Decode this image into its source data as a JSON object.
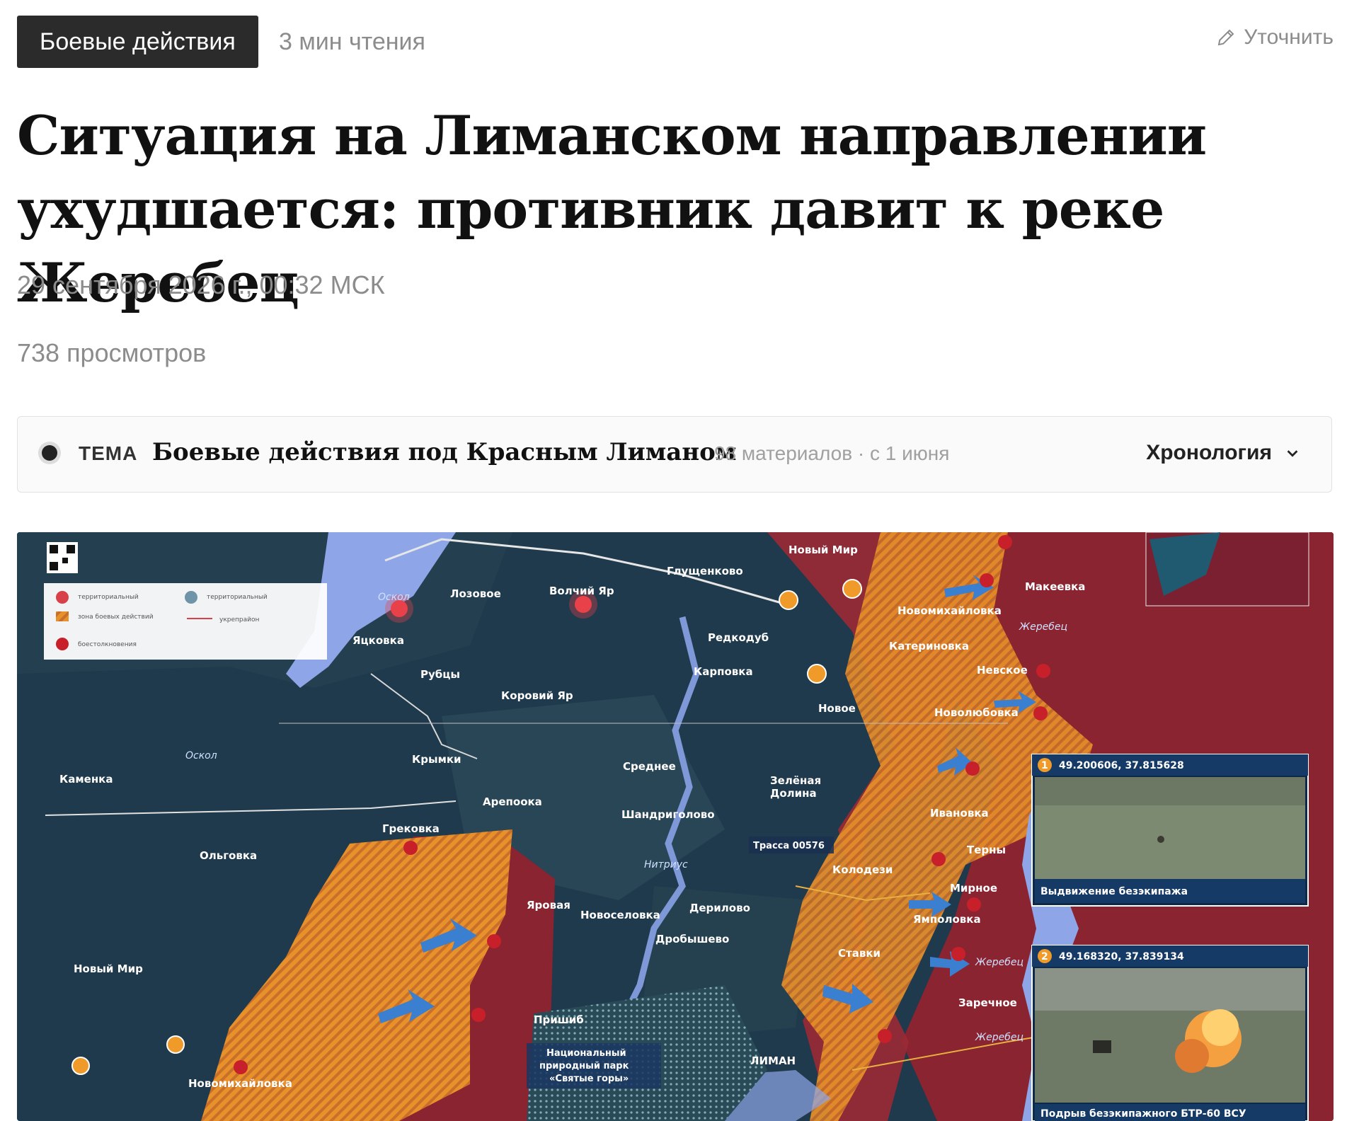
{
  "header": {
    "tag": "Боевые действия",
    "read_time": "3 мин чтения",
    "clarify": "Уточнить"
  },
  "article": {
    "title": "Ситуация на Лиманском направлении ухудшается: противник давит к реке Жеребец",
    "date": "29 сентября 2026 г., 00:32 МСК",
    "views": "738 просмотров"
  },
  "topic": {
    "tag": "ТЕМА",
    "title": "Боевые действия под Красным Лиманом",
    "meta": "98 материалов · с 1 июня",
    "chronology": "Хронология"
  },
  "map": {
    "places": [
      {
        "id": "lozovoe",
        "text": "Лозовое"
      },
      {
        "id": "volchiy",
        "text": "Волчий Яр"
      },
      {
        "id": "glush",
        "text": "Глущенково"
      },
      {
        "id": "novyimir1",
        "text": "Новый Мир"
      },
      {
        "id": "makeevka",
        "text": "Макеевка"
      },
      {
        "id": "novomikh1",
        "text": "Новомихайловка"
      },
      {
        "id": "zherebets1",
        "text": "Жеребец"
      },
      {
        "id": "yatskovka",
        "text": "Яцковка"
      },
      {
        "id": "rubtsy",
        "text": "Рубцы"
      },
      {
        "id": "redkodub",
        "text": "Редкодуб"
      },
      {
        "id": "katerinovka",
        "text": "Катериновка"
      },
      {
        "id": "karpovka",
        "text": "Карповка"
      },
      {
        "id": "nevskoe",
        "text": "Невское"
      },
      {
        "id": "koroviy",
        "text": "Коровий Яр"
      },
      {
        "id": "novoe",
        "text": "Новое"
      },
      {
        "id": "novolyub",
        "text": "Новолюбовка"
      },
      {
        "id": "oskol1",
        "text": "Оскол"
      },
      {
        "id": "oskol2",
        "text": "Оскол"
      },
      {
        "id": "kamenka",
        "text": "Каменка"
      },
      {
        "id": "krymki",
        "text": "Крымки"
      },
      {
        "id": "srednee",
        "text": "Среднее"
      },
      {
        "id": "zelenaya",
        "text": "Зелёная"
      },
      {
        "id": "dolina",
        "text": "Долина"
      },
      {
        "id": "arepovka",
        "text": "Арепоока"
      },
      {
        "id": "grekovka",
        "text": "Грековка"
      },
      {
        "id": "shandr",
        "text": "Шандриголово"
      },
      {
        "id": "ivanovka",
        "text": "Ивановка"
      },
      {
        "id": "olgovka",
        "text": "Ольговка"
      },
      {
        "id": "trassa",
        "text": "Трасса 00576"
      },
      {
        "id": "nitrius",
        "text": "Нитриус"
      },
      {
        "id": "kolodezi",
        "text": "Колодези"
      },
      {
        "id": "terny",
        "text": "Терны"
      },
      {
        "id": "mirnoe",
        "text": "Мирное"
      },
      {
        "id": "yarovaya",
        "text": "Яровая"
      },
      {
        "id": "novosel",
        "text": "Новоселовка"
      },
      {
        "id": "derilovo",
        "text": "Дерилово"
      },
      {
        "id": "yampolovka",
        "text": "Ямполовка"
      },
      {
        "id": "drobysh",
        "text": "Дробышево"
      },
      {
        "id": "novyimir2",
        "text": "Новый Мир"
      },
      {
        "id": "stavki",
        "text": "Ставки"
      },
      {
        "id": "zherebets2",
        "text": "Жеребец"
      },
      {
        "id": "zarechnoe",
        "text": "Заречное"
      },
      {
        "id": "zherebets3",
        "text": "Жеребец"
      },
      {
        "id": "prishib",
        "text": "Пришиб"
      },
      {
        "id": "liman",
        "text": "ЛИМАН"
      },
      {
        "id": "novomikh2",
        "text": "Новомихайловка"
      }
    ],
    "park": [
      "Национальный",
      "природный парк",
      "«Святые горы»"
    ],
    "video1": {
      "num": "1",
      "coords": "49.200606, 37.815628",
      "caption": "Выдвижение безэкипажа"
    },
    "video2": {
      "num": "2",
      "coords": "49.168320, 37.839134",
      "caption": "Подрыв безэкипажного БТР-60 ВСУ"
    }
  }
}
